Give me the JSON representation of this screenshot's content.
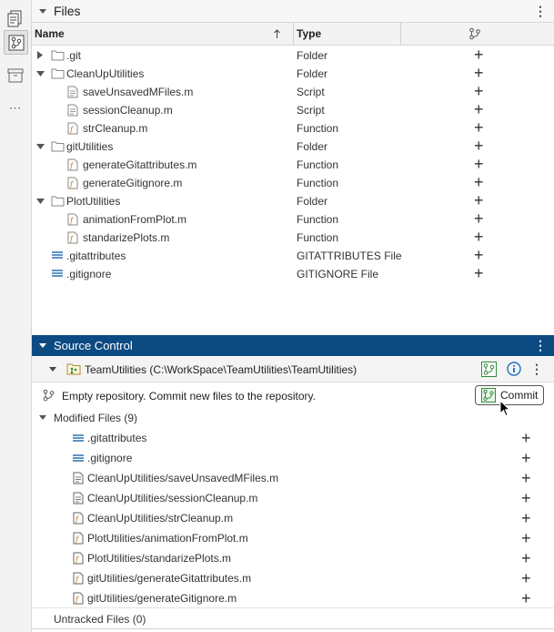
{
  "strip": {
    "icons": [
      "files-panel-icon",
      "source-control-icon",
      "archive-icon",
      "more-icon"
    ],
    "more_label": "⋯"
  },
  "files": {
    "title": "Files",
    "columns": {
      "name": "Name",
      "type": "Type"
    },
    "rows": [
      {
        "name": ".git",
        "type": "Folder",
        "kind": "folder",
        "expand": "collapsed"
      },
      {
        "name": "CleanUpUtilities",
        "type": "Folder",
        "kind": "folder",
        "expand": "expanded"
      },
      {
        "name": "saveUnsavedMFiles.m",
        "type": "Script",
        "kind": "script"
      },
      {
        "name": "sessionCleanup.m",
        "type": "Script",
        "kind": "script"
      },
      {
        "name": "strCleanup.m",
        "type": "Function",
        "kind": "function"
      },
      {
        "name": "gitUtilities",
        "type": "Folder",
        "kind": "folder",
        "expand": "expanded"
      },
      {
        "name": "generateGitattributes.m",
        "type": "Function",
        "kind": "function"
      },
      {
        "name": "generateGitignore.m",
        "type": "Function",
        "kind": "function"
      },
      {
        "name": "PlotUtilities",
        "type": "Folder",
        "kind": "folder",
        "expand": "expanded"
      },
      {
        "name": "animationFromPlot.m",
        "type": "Function",
        "kind": "function"
      },
      {
        "name": "standarizePlots.m",
        "type": "Function",
        "kind": "function"
      },
      {
        "name": ".gitattributes",
        "type": "GITATTRIBUTES File",
        "kind": "text"
      },
      {
        "name": ".gitignore",
        "type": "GITIGNORE File",
        "kind": "text"
      }
    ],
    "add_symbol": "+"
  },
  "source_control": {
    "title": "Source Control",
    "repo_label": "TeamUtilities (C:\\WorkSpace\\TeamUtilities\\TeamUtilities)",
    "status": "Empty repository. Commit new files to the repository.",
    "commit_label": "Commit",
    "modified_label": "Modified Files (9)",
    "modified": [
      {
        "name": ".gitattributes",
        "kind": "text"
      },
      {
        "name": ".gitignore",
        "kind": "text"
      },
      {
        "name": "CleanUpUtilities/saveUnsavedMFiles.m",
        "kind": "script"
      },
      {
        "name": "CleanUpUtilities/sessionCleanup.m",
        "kind": "script"
      },
      {
        "name": "CleanUpUtilities/strCleanup.m",
        "kind": "function"
      },
      {
        "name": "PlotUtilities/animationFromPlot.m",
        "kind": "function"
      },
      {
        "name": "PlotUtilities/standarizePlots.m",
        "kind": "function"
      },
      {
        "name": "gitUtilities/generateGitattributes.m",
        "kind": "function"
      },
      {
        "name": "gitUtilities/generateGitignore.m",
        "kind": "function"
      }
    ],
    "untracked_label": "Untracked Files (0)"
  },
  "colors": {
    "header_blue": "#0c4a82",
    "git_green": "#2e8b3c",
    "info_blue": "#1f6fc5",
    "text_lines": "#2f6fb0"
  }
}
